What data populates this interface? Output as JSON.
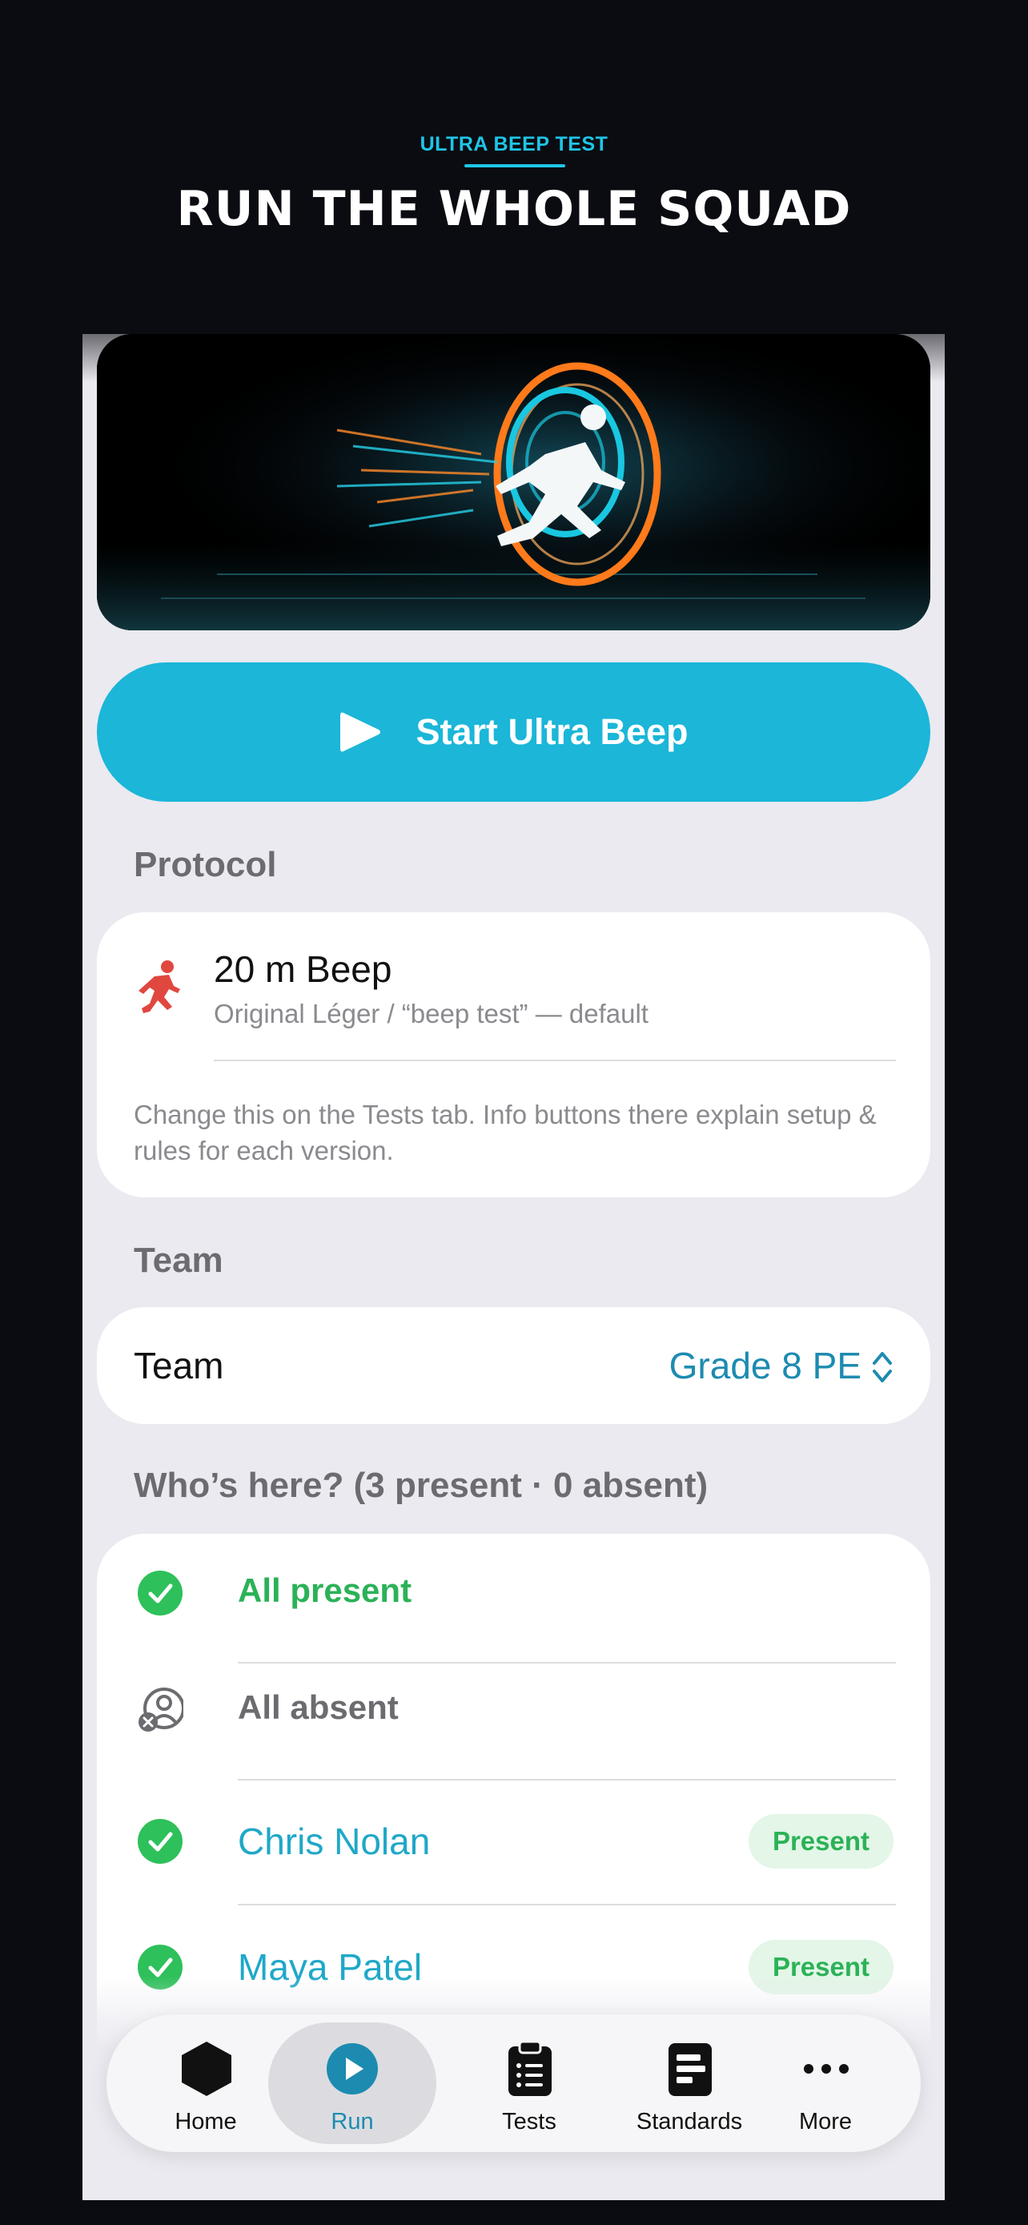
{
  "header": {
    "eyebrow": "ULTRA BEEP TEST",
    "headline": "RUN THE WHOLE SQUAD"
  },
  "start_button": {
    "label": "Start Ultra Beep",
    "icon": "play-icon"
  },
  "protocol": {
    "section_title": "Protocol",
    "name": "20 m Beep",
    "subtitle": "Original Léger / “beep test” — default",
    "note": "Change this on the Tests tab. Info buttons there explain setup & rules for each version.",
    "icon": "running-person-icon"
  },
  "team": {
    "section_title": "Team",
    "label": "Team",
    "value": "Grade 8 PE"
  },
  "attendance": {
    "section_title": "Who’s here? (3 present · 0 absent)",
    "all_present": "All present",
    "all_absent": "All absent",
    "students": [
      {
        "name": "Chris Nolan",
        "status": "Present"
      },
      {
        "name": "Maya Patel",
        "status": "Present"
      }
    ]
  },
  "tabbar": {
    "tabs": [
      {
        "label": "Home",
        "icon": "hexagon-icon"
      },
      {
        "label": "Run",
        "icon": "play-circle-icon",
        "active": true
      },
      {
        "label": "Tests",
        "icon": "clipboard-icon"
      },
      {
        "label": "Standards",
        "icon": "document-icon"
      },
      {
        "label": "More",
        "icon": "ellipsis-icon"
      }
    ]
  },
  "colors": {
    "accent": "#1bb6d8",
    "link": "#1d8bb0",
    "success": "#2bb257",
    "background": "#0a0c12"
  }
}
